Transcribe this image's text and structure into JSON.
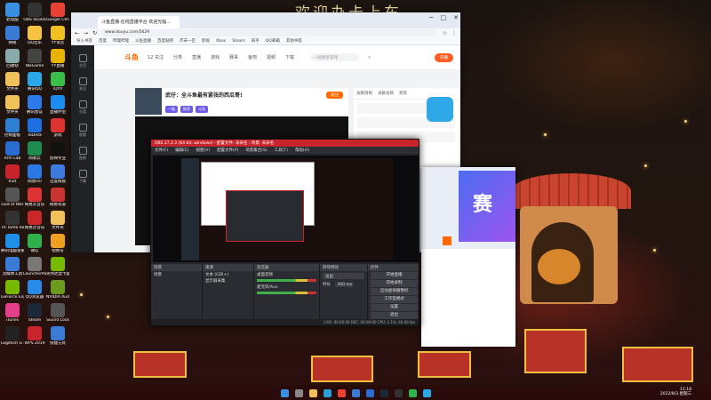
{
  "wallpaper": {
    "title": "欢迎办卡上车"
  },
  "desktop_icons": [
    {
      "label": "此电脑",
      "color": "#3b8fe0"
    },
    {
      "label": "OBS Studio",
      "color": "#333"
    },
    {
      "label": "Google Chrome",
      "color": "#e94235"
    },
    {
      "label": "网络",
      "color": "#3a7bd5"
    },
    {
      "label": "QQ音乐",
      "color": "#f6c343"
    },
    {
      "label": "YY语音",
      "color": "#f0c020"
    },
    {
      "label": "回收站",
      "color": "#8aa"
    },
    {
      "label": "WeGame",
      "color": "#444"
    },
    {
      "label": "YY直播",
      "color": "#e8b400"
    },
    {
      "label": "文件夹",
      "color": "#f0c05a"
    },
    {
      "label": "腾讯QQ",
      "color": "#2aa7e8"
    },
    {
      "label": "iQIYI",
      "color": "#3cbf4a"
    },
    {
      "label": "文件夹",
      "color": "#f0c05a"
    },
    {
      "label": "腾讯会议",
      "color": "#2a7be8"
    },
    {
      "label": "直播伴侣",
      "color": "#1d8cf0"
    },
    {
      "label": "控制面板",
      "color": "#2f7fd4"
    },
    {
      "label": "ToDesk",
      "color": "#1e6fe0"
    },
    {
      "label": "游戏",
      "color": "#d33"
    },
    {
      "label": "Arm Lab",
      "color": "#2a6bd0"
    },
    {
      "label": "网易云",
      "color": "#1d8a4e"
    },
    {
      "label": "剪映专业",
      "color": "#111"
    },
    {
      "label": "Riot",
      "color": "#c8242c"
    },
    {
      "label": "网易UU",
      "color": "#2b78e4"
    },
    {
      "label": "百度网盘",
      "color": "#3b7be0"
    },
    {
      "label": "God of War",
      "color": "#555"
    },
    {
      "label": "网易云音乐",
      "color": "#d33"
    },
    {
      "label": "网易有道",
      "color": "#c33"
    },
    {
      "label": "TR Tomb Raider",
      "color": "#333"
    },
    {
      "label": "网易云音乐",
      "color": "#c82828"
    },
    {
      "label": "文件夹",
      "color": "#f0c05a"
    },
    {
      "label": "腾讯电脑管家",
      "color": "#1f8fe8"
    },
    {
      "label": "微信",
      "color": "#2fb24c"
    },
    {
      "label": "视频号",
      "color": "#f0a020"
    },
    {
      "label": "流媒体工具",
      "color": "#3a7bd5"
    },
    {
      "label": "LauncherPatcher",
      "color": "#777"
    },
    {
      "label": "英伟达显卡驱动",
      "color": "#76b900"
    },
    {
      "label": "GeForce Experience",
      "color": "#76b900"
    },
    {
      "label": "QQ浏览器",
      "color": "#2a8ae8"
    },
    {
      "label": "NVIDIA Audio",
      "color": "#6a9a1e"
    },
    {
      "label": "iTunes",
      "color": "#e33f8a"
    },
    {
      "label": "Steam",
      "color": "#1b2838"
    },
    {
      "label": "Sound Lock",
      "color": "#555"
    },
    {
      "label": "Logitech G HUB",
      "color": "#222"
    },
    {
      "label": "WPS 2019",
      "color": "#c8242c"
    },
    {
      "label": "快捷方式",
      "color": "#3a7bd5"
    }
  ],
  "browser": {
    "tab_title": "斗鱼直播-在线直播平台 欢迎光临...",
    "url": "www.douyu.com/5629",
    "bookmarks": [
      "导入书签",
      "百度",
      "哔哩哔哩",
      "斗鱼直播",
      "百度贴吧",
      "芥末一区",
      "影视",
      "Xbox",
      "Steam",
      "知乎",
      "QQ邮箱",
      "其他书签"
    ],
    "site_logo": "斗鱼",
    "nav_items": [
      "12 关注",
      "分类",
      "直播",
      "游戏",
      "赛事",
      "鱼吧",
      "视频",
      "下载"
    ],
    "search_placeholder": "一起畅享游戏",
    "open_live_button": "开播",
    "room_title": "武仔：全斗鱼最有紧张的西瓜哥!",
    "room_tags": [
      "一级",
      "推荐",
      "斗鱼"
    ],
    "follow_button": "关注",
    "side_labels": [
      "主页",
      "关注",
      "分类",
      "视频",
      "鱼吧",
      "下载"
    ],
    "panel_tabs": [
      "贡献周榜",
      "贡献总榜",
      "贵宾"
    ],
    "chat_tabs": [
      "粉丝团",
      "聊天"
    ]
  },
  "obs": {
    "title": "OBS 27.2.3 (64 bit, windows) - 配置文件: 未命名 - 场景: 未命名",
    "menu": [
      "文件(F)",
      "编辑(E)",
      "视图(V)",
      "配置文件(P)",
      "场景集合(S)",
      "工具(T)",
      "帮助(H)"
    ],
    "docks": {
      "scenes": {
        "title": "场景",
        "items": [
          "场景"
        ]
      },
      "sources": {
        "title": "来源",
        "items": [
          "文本 (GDI+)",
          "显示器采集"
        ]
      },
      "mixer": {
        "title": "混音器",
        "channels": [
          "桌面音频",
          "麦克风/Aux"
        ]
      },
      "transitions": {
        "title": "转场特效",
        "type": "淡出",
        "duration_label": "时长",
        "duration": "300 ms"
      },
      "controls": {
        "title": "控件",
        "buttons": [
          "开始直播",
          "开始录制",
          "启动虚拟摄像机",
          "工作室模式",
          "设置",
          "退出"
        ]
      }
    },
    "status": "LIVE: 00:00:00  REC: 00:00:00  CPU: 2.1%, 60.00 fps"
  },
  "side_window": {
    "title": "赛",
    "labels": [
      "赛事",
      "直播"
    ]
  },
  "taskbar": {
    "icons": [
      "windows",
      "search",
      "file-explorer",
      "edge",
      "chrome",
      "store",
      "mail",
      "steam",
      "obs",
      "wechat",
      "qq"
    ],
    "time": "11:18",
    "date": "2022/8/3 星期三"
  }
}
